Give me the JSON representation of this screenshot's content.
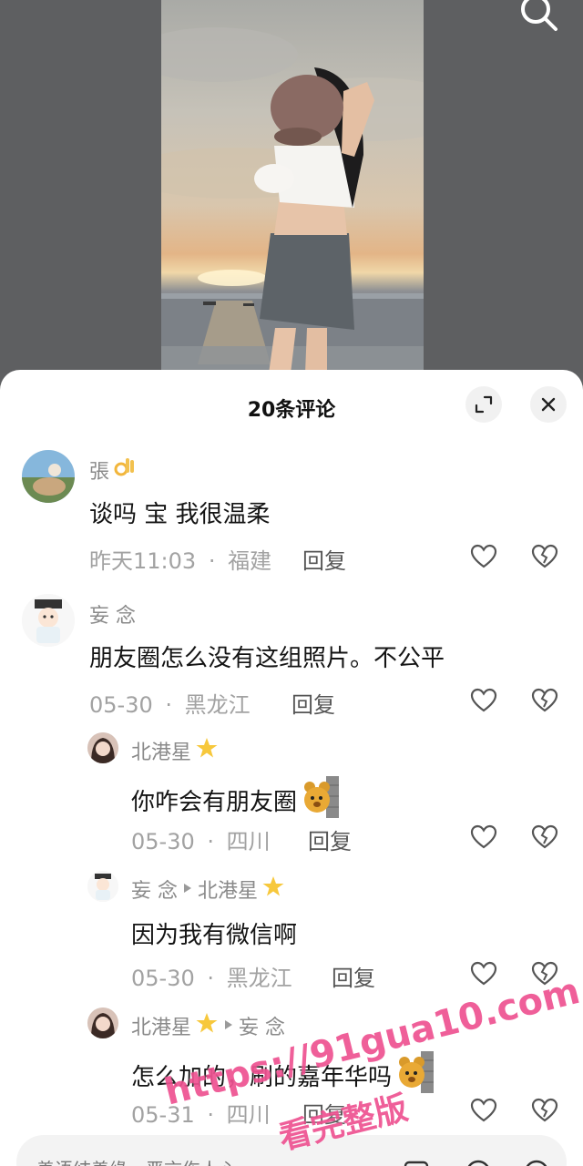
{
  "sheet": {
    "title": "20条评论",
    "expand_icon": "expand-icon",
    "close_icon": "close-icon"
  },
  "comments": [
    {
      "name": "張",
      "name_emoji": "ok-hand-emoji",
      "text": "谈吗 宝 我很温柔",
      "time": "昨天11:03",
      "location": "福建",
      "reply_label": "回复"
    },
    {
      "name": "妄 念",
      "text": "朋友圈怎么没有这组照片。不公平",
      "time": "05-30",
      "location": "黑龙江",
      "reply_label": "回复"
    },
    {
      "name": "北港星",
      "name_emoji": "star-emoji",
      "text": "你咋会有朋友圈",
      "text_emoji": "bear-peeking-emoji",
      "time": "05-30",
      "location": "四川",
      "reply_label": "回复"
    },
    {
      "name": "妄 念",
      "reply_to": "北港星",
      "reply_to_emoji": "star-emoji",
      "text": "因为我有微信啊",
      "time": "05-30",
      "location": "黑龙江",
      "reply_label": "回复"
    },
    {
      "name": "北港星",
      "name_emoji": "star-emoji",
      "reply_to": "妄 念",
      "text": "怎么加的，刷的嘉年华吗",
      "text_emoji": "bear-peeking-emoji",
      "time": "05-31",
      "location": "四川",
      "reply_label": "回复"
    }
  ],
  "separator": "·",
  "input": {
    "placeholder": "善语结善缘，恶言伤人心",
    "icons": [
      "image-icon",
      "at-icon",
      "emoji-icon"
    ]
  },
  "watermark": {
    "url": "https://91gua10.com",
    "slogan": "看完整版",
    "color": "#eb3c82"
  },
  "colors": {
    "sheet_bg": "#ffffff",
    "muted_text": "#a2a2a2",
    "name_text": "#8a8a8a"
  }
}
